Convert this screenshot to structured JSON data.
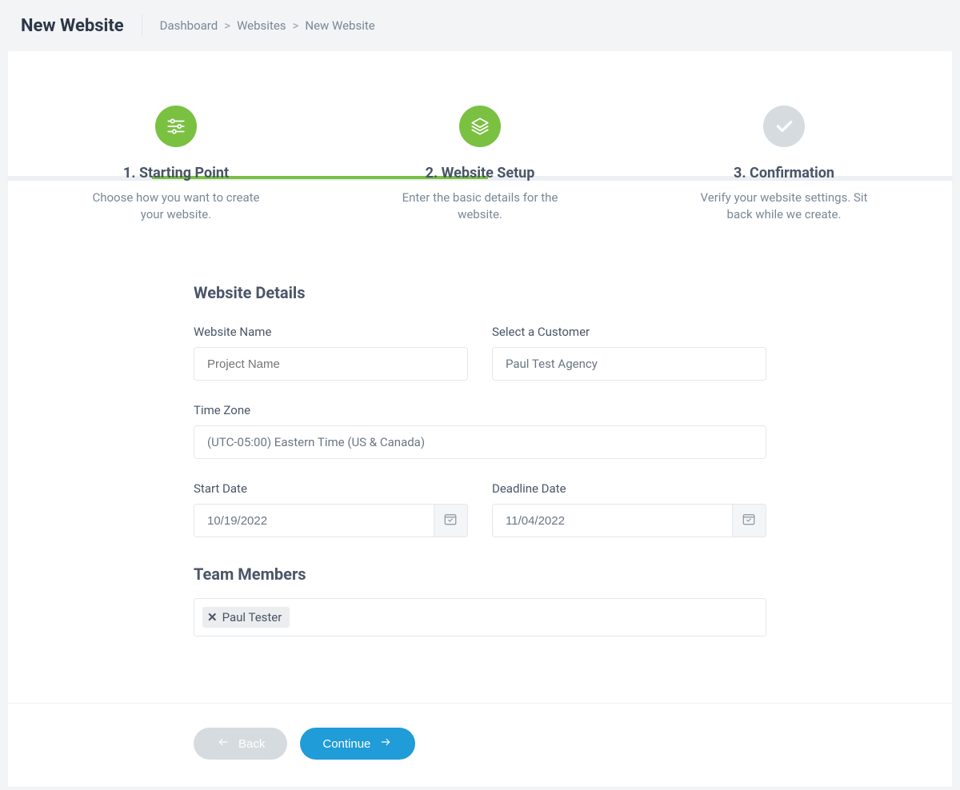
{
  "header": {
    "title": "New Website",
    "breadcrumb": {
      "dashboard": "Dashboard",
      "websites": "Websites",
      "current": "New Website"
    }
  },
  "stepper": {
    "step1": {
      "title": "1. Starting Point",
      "desc": "Choose how you want to create your website."
    },
    "step2": {
      "title": "2. Website Setup",
      "desc": "Enter the basic details for the website."
    },
    "step3": {
      "title": "3. Confirmation",
      "desc": "Verify your website settings. Sit back while we create."
    }
  },
  "form": {
    "section_details": "Website Details",
    "website_name_label": "Website Name",
    "website_name_placeholder": "Project Name",
    "customer_label": "Select a Customer",
    "customer_value": "Paul Test Agency",
    "timezone_label": "Time Zone",
    "timezone_value": "(UTC-05:00) Eastern Time (US & Canada)",
    "start_date_label": "Start Date",
    "start_date_value": "10/19/2022",
    "deadline_label": "Deadline Date",
    "deadline_value": "11/04/2022",
    "section_team": "Team Members",
    "team_tag": "Paul Tester"
  },
  "footer": {
    "back_label": "Back",
    "continue_label": "Continue"
  }
}
